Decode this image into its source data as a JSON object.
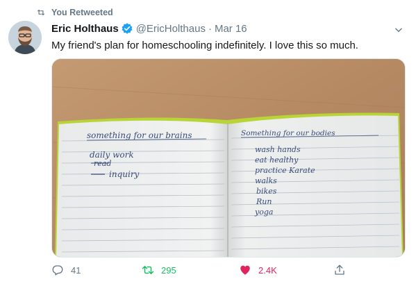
{
  "retweet_label": "You Retweeted",
  "author": {
    "name": "Eric Holthaus",
    "handle": "@EricHolthaus",
    "separator": "·",
    "date": "Mar 16",
    "verified": true
  },
  "tweet_text": "My friend's plan for homeschooling indefinitely. I love this so much.",
  "notebook": {
    "left_page": {
      "heading": "something for our brains",
      "items": [
        "daily work",
        "read",
        "inquiry"
      ]
    },
    "right_page": {
      "heading": "Something for our bodies",
      "items": [
        "wash hands",
        "eat healthy",
        "practice Karate",
        "walks",
        "bikes",
        "Run",
        "yoga"
      ]
    }
  },
  "actions": {
    "replies": "41",
    "retweets": "295",
    "likes": "2.4K"
  },
  "colors": {
    "secondary_text": "#657786",
    "retweet_green": "#17bf63",
    "like_pink": "#e0245e",
    "verified_blue": "#1da1f2"
  }
}
